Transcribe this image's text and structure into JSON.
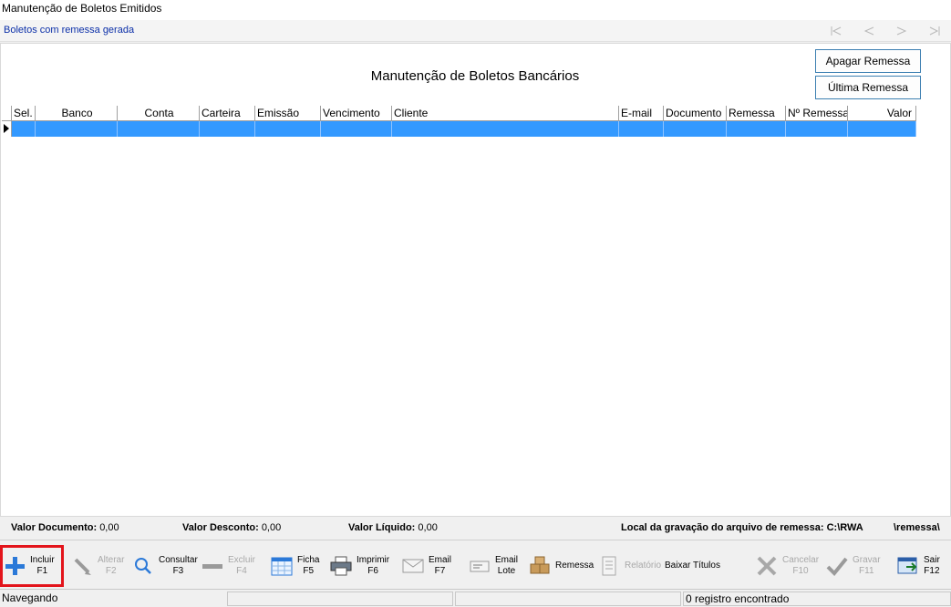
{
  "window": {
    "title": "Manutenção de Boletos Emitidos"
  },
  "subbar": {
    "subtitle": "Boletos com remessa gerada",
    "nav": [
      "first-icon",
      "prev-icon",
      "next-icon",
      "last-icon"
    ]
  },
  "main": {
    "heading": "Manutenção de Boletos Bancários",
    "buttons": {
      "apagar": "Apagar Remessa",
      "ultima": "Última Remessa"
    },
    "columns": [
      "Sel.",
      "Banco",
      "Conta",
      "Carteira",
      "Emissão",
      "Vencimento",
      "Cliente",
      "E-mail",
      "Documento",
      "Remessa",
      "Nº Remessa",
      "Valor"
    ],
    "selection_color": "#3399ff"
  },
  "totals": {
    "valor_documento_label": "Valor Documento:",
    "valor_documento": "0,00",
    "valor_desconto_label": "Valor Desconto:",
    "valor_desconto": "0,00",
    "valor_liquido_label": "Valor Líquido:",
    "valor_liquido": "0,00",
    "local_label": "Local da gravação do arquivo de remessa: C:\\RWA",
    "local_suffix": "\\remessa\\"
  },
  "toolbar": {
    "incluir": {
      "l1": "Incluir",
      "l2": "F1"
    },
    "alterar": {
      "l1": "Alterar",
      "l2": "F2"
    },
    "consultar": {
      "l1": "Consultar",
      "l2": "F3"
    },
    "excluir": {
      "l1": "Excluir",
      "l2": "F4"
    },
    "ficha": {
      "l1": "Ficha",
      "l2": "F5"
    },
    "imprimir": {
      "l1": "Imprimir",
      "l2": "F6"
    },
    "email": {
      "l1": "Email",
      "l2": "F7"
    },
    "email_lote": {
      "l1": "Email",
      "l2": "Lote"
    },
    "remessa": {
      "l1": "Remessa"
    },
    "relatorio": {
      "l1": "Relatório"
    },
    "baixar": {
      "l1": "Baixar Títulos"
    },
    "cancelar": {
      "l1": "Cancelar",
      "l2": "F10"
    },
    "gravar": {
      "l1": "Gravar",
      "l2": "F11"
    },
    "sair": {
      "l1": "Sair",
      "l2": "F12"
    },
    "highlight_color": "#e3141b"
  },
  "status": {
    "mode": "Navegando",
    "records": "0 registro encontrado"
  }
}
